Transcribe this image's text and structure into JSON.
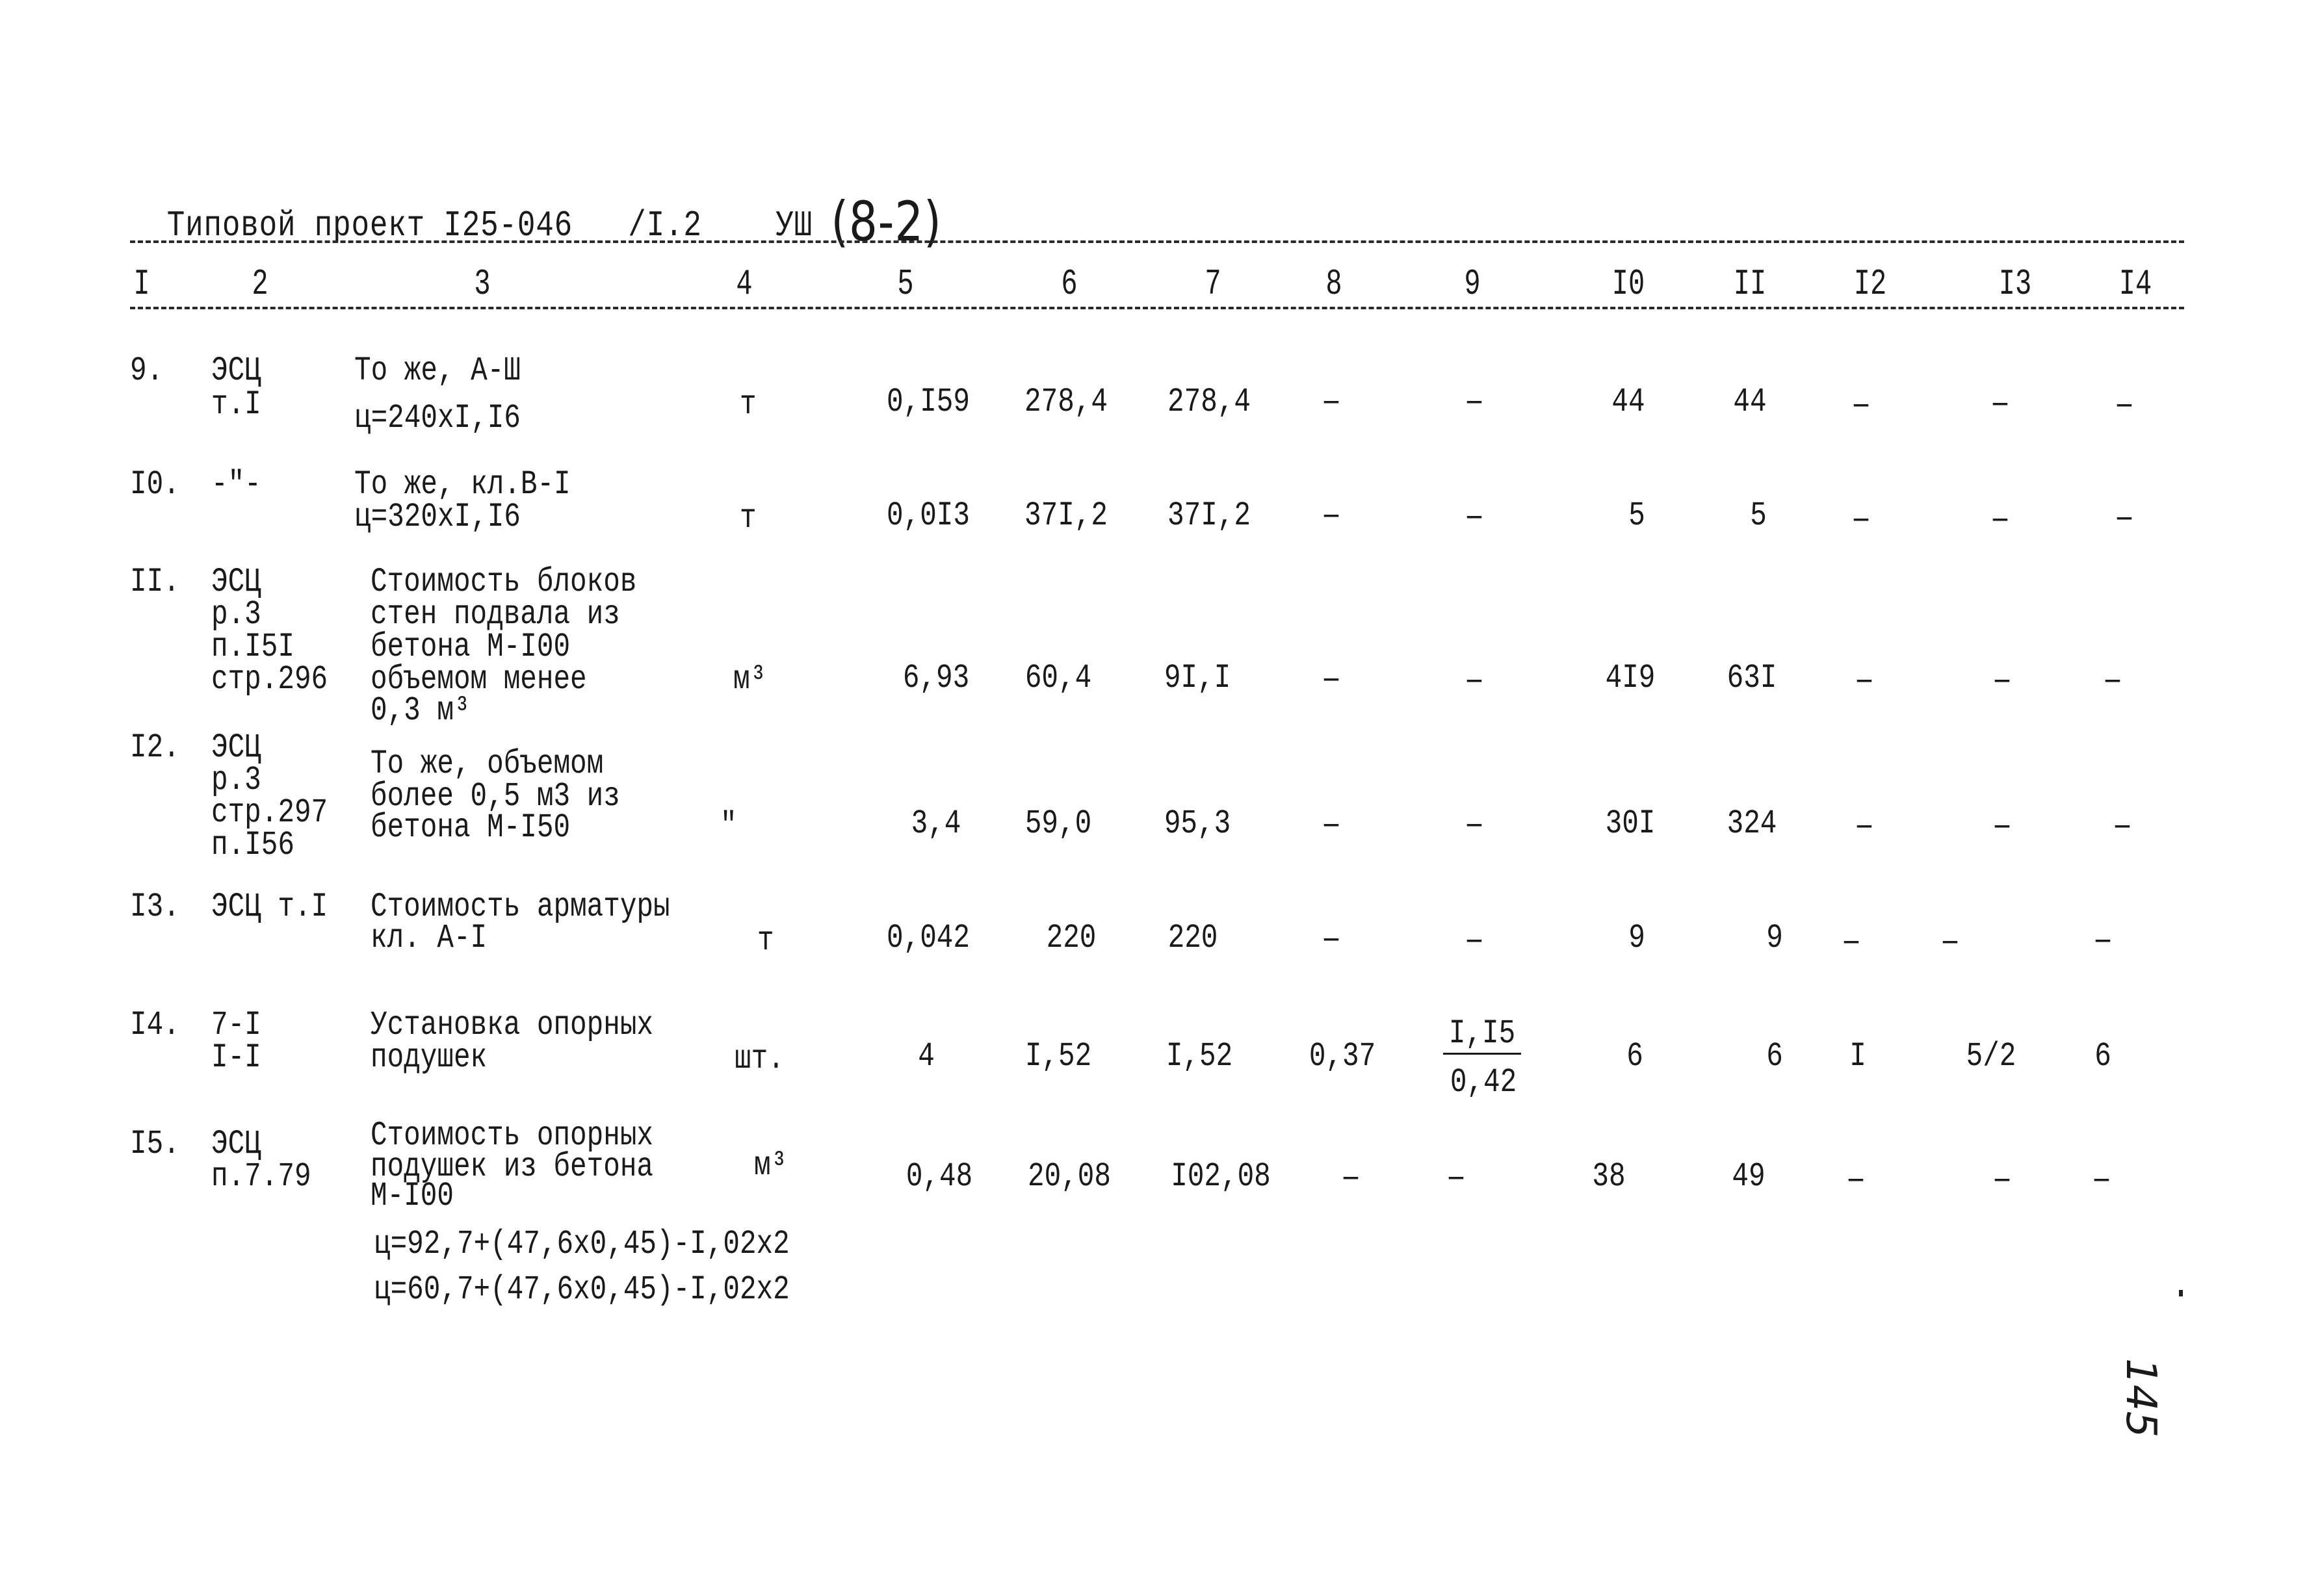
{
  "header": {
    "project_label": "Типовой проект І25-046",
    "part": "/І.2",
    "section": "УШ",
    "sheet_mark": "(8-2)"
  },
  "column_numbers": [
    "І",
    "2",
    "3",
    "4",
    "5",
    "6",
    "7",
    "8",
    "9",
    "І0",
    "ІІ",
    "І2",
    "І3",
    "І4"
  ],
  "rows": [
    {
      "no": "9.",
      "ref": [
        "ЭСЦ",
        "т.І"
      ],
      "desc": [
        "То же, А-Ш",
        "ц=240хІ,І6"
      ],
      "unit": "т",
      "c5": "0,І59",
      "c6": "278,4",
      "c7": "278,4",
      "c8": "–",
      "c9": "–",
      "c10": "44",
      "c11": "44",
      "c12": "–",
      "c13": "–",
      "c14": "–"
    },
    {
      "no": "І0.",
      "ref": [
        "-\"-"
      ],
      "desc": [
        "То же, кл.В-І",
        "ц=320хІ,І6"
      ],
      "unit": "т",
      "c5": "0,0І3",
      "c6": "37І,2",
      "c7": "37І,2",
      "c8": "–",
      "c9": "–",
      "c10": "5",
      "c11": "5",
      "c12": "–",
      "c13": "–",
      "c14": "–"
    },
    {
      "no": "ІІ.",
      "ref": [
        "ЭСЦ",
        "р.3",
        "п.І5І",
        "стр.296"
      ],
      "desc": [
        "Стоимость блоков",
        "стен подвала из",
        "бетона М-І00",
        "объемом менее",
        "0,3 м³"
      ],
      "unit": "м³",
      "c5": "6,93",
      "c6": "60,4",
      "c7": "9І,І",
      "c8": "–",
      "c9": "–",
      "c10": "4І9",
      "c11": "63І",
      "c12": "–",
      "c13": "–",
      "c14": "–"
    },
    {
      "no": "І2.",
      "ref": [
        "ЭСЦ",
        "р.3",
        "стр.297",
        "п.І56"
      ],
      "desc": [
        "То же, объемом",
        "более 0,5 м3 из",
        "бетона М-І50"
      ],
      "unit": "\"",
      "c5": "3,4",
      "c6": "59,0",
      "c7": "95,3",
      "c8": "–",
      "c9": "–",
      "c10": "30І",
      "c11": "324",
      "c12": "–",
      "c13": "–",
      "c14": "–"
    },
    {
      "no": "І3.",
      "ref": [
        "ЭСЦ т.І"
      ],
      "desc": [
        "Стоимость арматуры",
        "кл. А-І"
      ],
      "unit": "т",
      "c5": "0,042",
      "c6": "220",
      "c7": "220",
      "c8": "–",
      "c9": "–",
      "c10": "9",
      "c11": "9",
      "c12": "–",
      "c13": "–",
      "c14": "–"
    },
    {
      "no": "І4.",
      "ref": [
        "7-І",
        "І-І"
      ],
      "desc": [
        "Установка опорных",
        "подушек"
      ],
      "unit": "шт.",
      "c5": "4",
      "c6": "І,52",
      "c7": "І,52",
      "c8": "0,37",
      "c9_num": "І,І5",
      "c9_den": "0,42",
      "c10": "6",
      "c11": "6",
      "c12": "І",
      "c13": "5/2",
      "c14": "6"
    },
    {
      "no": "І5.",
      "ref": [
        "ЭСЦ",
        "п.7.79"
      ],
      "desc": [
        "Стоимость опорных",
        "подушек из бетона",
        "М-І00"
      ],
      "unit": "м³",
      "c5": "0,48",
      "c6": "20,08",
      "c7": "І02,08",
      "c8": "–",
      "c9": "–",
      "c10": "38",
      "c11": "49",
      "c12": "–",
      "c13": "–",
      "c14": "–"
    }
  ],
  "formulas": [
    "ц=92,7+(47,6х0,45)-І,02х2",
    "ц=60,7+(47,6х0,45)-І,02х2"
  ],
  "page_number": "145"
}
